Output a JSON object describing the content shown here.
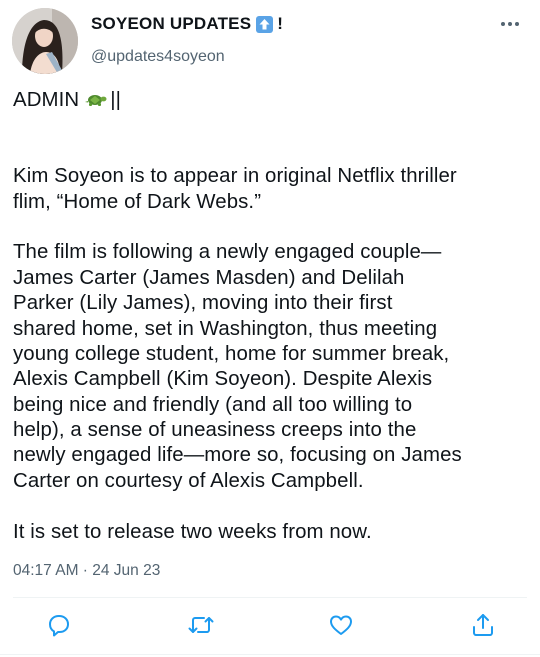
{
  "tweet": {
    "author": {
      "display_name": "SOYEON UPDATES",
      "name_emoji": "up-arrow-emoji",
      "name_suffix": "!",
      "handle": "@updates4soyeon",
      "avatar": "profile-photo"
    },
    "body": {
      "first_line_text": "ADMIN",
      "first_line_emoji": "turtle-emoji",
      "first_line_suffix": "||",
      "paragraph1": [
        "Kim Soyeon is to appear in original Netflix thriller",
        "flim, “Home of Dark Webs.”"
      ],
      "paragraph2": [
        "The film is following a newly engaged couple—",
        "James Carter (James Masden) and Delilah",
        "Parker (Lily James), moving into their first",
        "shared home, set in Washington, thus meeting",
        "young college student, home for summer break,",
        "Alexis Campbell (Kim Soyeon). Despite Alexis",
        "being nice and friendly (and all too willing to",
        "help), a sense of uneasiness creeps into the",
        "newly engaged life—more so, focusing on James",
        "Carter on courtesy of Alexis Campbell."
      ],
      "paragraph3": [
        "It is set to release two weeks from now."
      ]
    },
    "timestamp": "04:17 AM · 24 Jun 23",
    "actions": {
      "reply": "reply-icon",
      "retweet": "retweet-icon",
      "like": "heart-icon",
      "share": "share-icon"
    },
    "colors": {
      "text": "#0f1419",
      "secondary": "#536471",
      "icon": "#1d9bf0",
      "divider": "#eff3f4"
    }
  }
}
